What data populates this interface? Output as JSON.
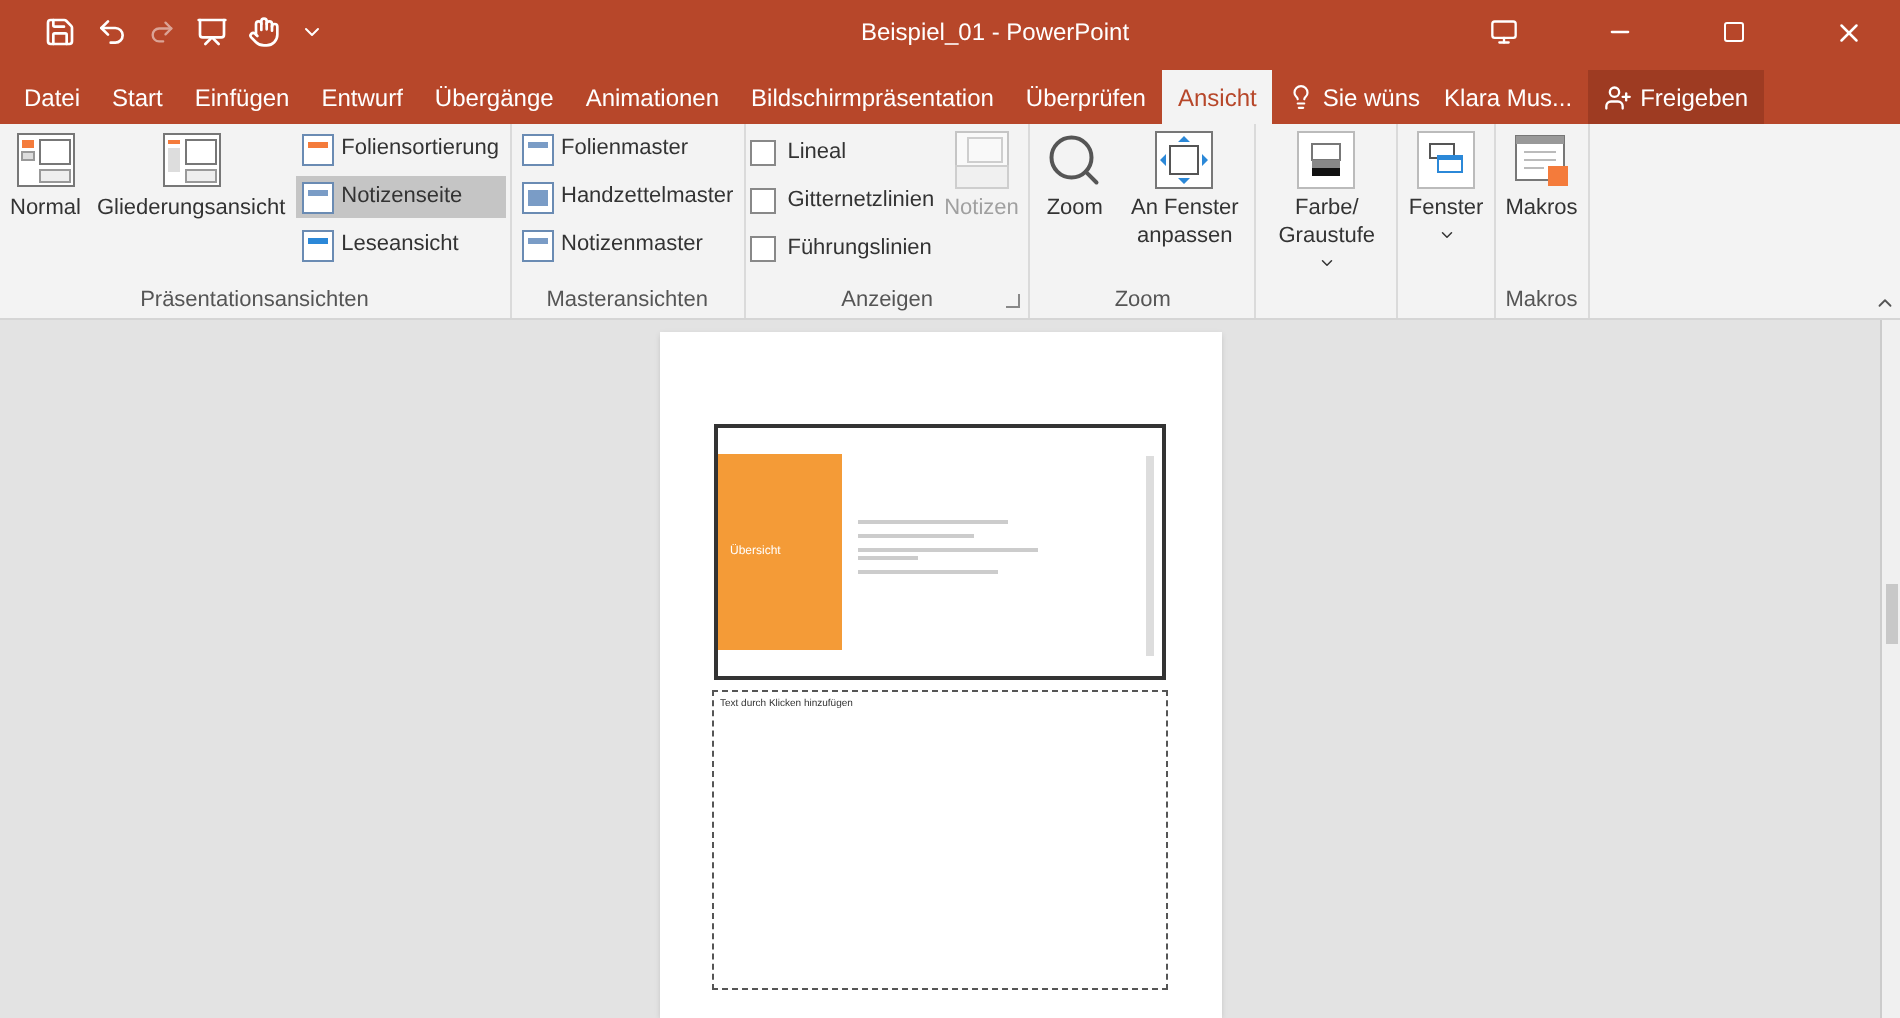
{
  "window": {
    "title": "Beispiel_01 - PowerPoint"
  },
  "tabs": [
    {
      "label": "Datei",
      "selected": false
    },
    {
      "label": "Start",
      "selected": false
    },
    {
      "label": "Einfügen",
      "selected": false
    },
    {
      "label": "Entwurf",
      "selected": false
    },
    {
      "label": "Übergänge",
      "selected": false
    },
    {
      "label": "Animationen",
      "selected": false
    },
    {
      "label": "Bildschirmpräsentation",
      "selected": false
    },
    {
      "label": "Überprüfen",
      "selected": false
    },
    {
      "label": "Ansicht",
      "selected": true
    }
  ],
  "tell_me": {
    "placeholder": "Sie wüns"
  },
  "user": "Klara Mus...",
  "share": "Freigeben",
  "ribbon_groups": [
    {
      "label": "Präsentationsansichten",
      "items": [
        {
          "kind": "large",
          "label": "Normal",
          "disabled": false
        },
        {
          "kind": "large",
          "label": "Gliederungsansicht",
          "disabled": false
        },
        {
          "kind": "stack",
          "buttons": [
            {
              "label": "Foliensortierung",
              "selected": false
            },
            {
              "label": "Notizenseite",
              "selected": true
            },
            {
              "label": "Leseansicht",
              "selected": false
            }
          ]
        }
      ]
    },
    {
      "label": "Masteransichten",
      "items": [
        {
          "kind": "stack",
          "buttons": [
            {
              "label": "Folienmaster",
              "selected": false
            },
            {
              "label": "Handzettelmaster",
              "selected": false
            },
            {
              "label": "Notizenmaster",
              "selected": false
            }
          ]
        }
      ]
    },
    {
      "label": "Anzeigen",
      "items": [
        {
          "kind": "checks",
          "boxes": [
            {
              "label": "Lineal",
              "checked": false
            },
            {
              "label": "Gitternetzlinien",
              "checked": false
            },
            {
              "label": "Führungslinien",
              "checked": false
            }
          ]
        },
        {
          "kind": "large",
          "label": "Notizen",
          "disabled": true
        }
      ]
    },
    {
      "label": "Zoom",
      "items": [
        {
          "kind": "large",
          "label": "Zoom",
          "disabled": false
        },
        {
          "kind": "large",
          "label": "An Fenster anpassen",
          "disabled": false
        }
      ]
    },
    {
      "items": [
        {
          "kind": "large",
          "label": "Farbe/ Graustufe",
          "dropdown": true,
          "disabled": false
        }
      ]
    },
    {
      "items": [
        {
          "kind": "large",
          "label": "Fenster",
          "dropdown": true,
          "disabled": false
        }
      ]
    },
    {
      "label": "Makros",
      "items": [
        {
          "kind": "large",
          "label": "Makros",
          "disabled": false
        }
      ]
    }
  ],
  "slide": {
    "title": "Übersicht"
  },
  "notes": {
    "placeholder": "Text durch Klicken hinzufügen"
  }
}
